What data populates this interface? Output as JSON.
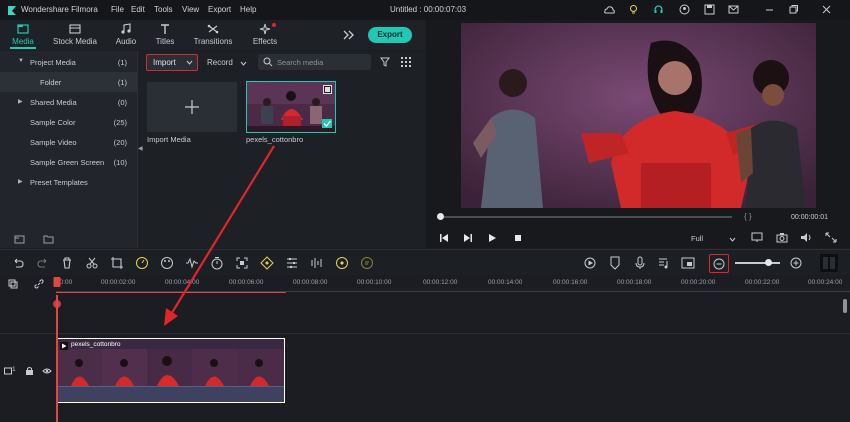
{
  "app": {
    "name": "Wondershare Filmora",
    "document_title": "Untitled : 00:00:07:03"
  },
  "menu": [
    "File",
    "Edit",
    "Tools",
    "View",
    "Export",
    "Help"
  ],
  "tabs": [
    {
      "label": "Media",
      "icon": "media-folder-icon",
      "active": true
    },
    {
      "label": "Stock Media",
      "icon": "stock-media-icon"
    },
    {
      "label": "Audio",
      "icon": "audio-note-icon"
    },
    {
      "label": "Titles",
      "icon": "titles-t-icon"
    },
    {
      "label": "Transitions",
      "icon": "transitions-icon"
    },
    {
      "label": "Effects",
      "icon": "effects-sparkle-icon"
    }
  ],
  "export_label": "Export",
  "left_panel": {
    "items": [
      {
        "label": "Project Media",
        "count": "(1)",
        "expanded": true
      },
      {
        "label": "Folder",
        "count": "(1)",
        "selected": true
      },
      {
        "label": "Shared Media",
        "count": "(0)"
      },
      {
        "label": "Sample Color",
        "count": "(25)"
      },
      {
        "label": "Sample Video",
        "count": "(20)"
      },
      {
        "label": "Sample Green Screen",
        "count": "(10)"
      },
      {
        "label": "Preset Templates",
        "count": ""
      }
    ]
  },
  "media_toolbar": {
    "import_label": "Import",
    "record_label": "Record",
    "search_placeholder": "Search media"
  },
  "media_items": [
    {
      "label": "Import Media"
    },
    {
      "label": "pexels_cottonbro"
    }
  ],
  "player": {
    "timecode": "00:00:00:01",
    "quality": "Full",
    "brackets": "{   }",
    "progress": 0.0
  },
  "ruler_labels": [
    "00:00",
    "00:00:02:00",
    "00:00:04:00",
    "00:00:06:00",
    "00:00:08:00",
    "00:00:10:00",
    "00:00:12:00",
    "00:00:14:00",
    "00:00:16:00",
    "00:00:18:00",
    "00:00:20:00",
    "00:00:22:00",
    "00:00:24:00"
  ],
  "clip": {
    "name": "pexels_cottonbro"
  },
  "track": {
    "label": "1"
  },
  "colors": {
    "accent": "#20c9b5",
    "highlight_red": "#e0262a",
    "playhead": "#e2473f",
    "clip_border": "#ffffff"
  }
}
